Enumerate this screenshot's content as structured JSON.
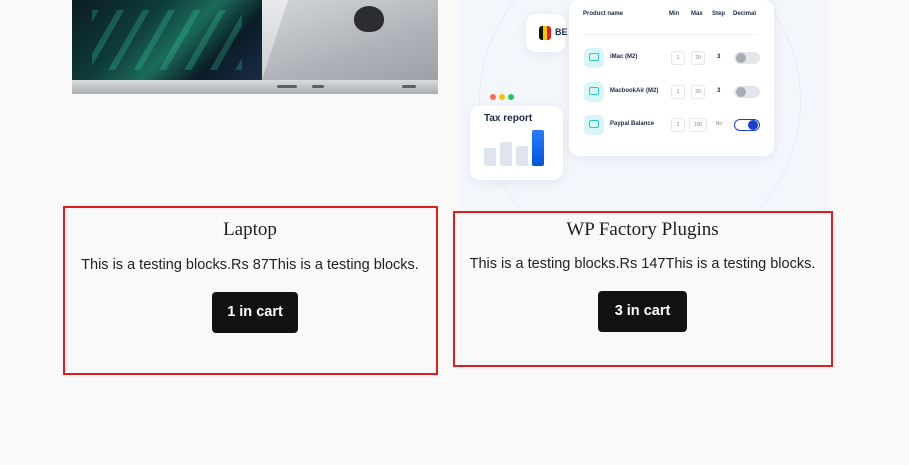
{
  "products": [
    {
      "title": "Laptop",
      "description": "This is a testing blocks.Rs 87This is a testing blocks.",
      "button_label": "1 in cart"
    },
    {
      "title": "WP Factory Plugins",
      "description": "This is a testing blocks.Rs 147This is a testing blocks.",
      "button_label": "3 in cart",
      "thumbnail": {
        "flag_text": "BE",
        "tax_card_title": "Tax report",
        "table_headers": [
          "Product name",
          "Min",
          "Max",
          "Step",
          "Decimal"
        ],
        "rows": [
          {
            "name": "iMac (M2)",
            "min": "1",
            "max": "20",
            "step": "3",
            "decimal": "off"
          },
          {
            "name": "MacbookAir (M2)",
            "min": "1",
            "max": "20",
            "step": "3",
            "decimal": "off"
          },
          {
            "name": "Paypal Balance",
            "min": "1",
            "max": "100",
            "step": "No",
            "decimal": "on"
          }
        ]
      }
    }
  ],
  "colors": {
    "highlight_border": "#e31c1c",
    "button_bg": "#121212",
    "button_text": "#ffffff",
    "page_bg": "#f9f9f9"
  }
}
